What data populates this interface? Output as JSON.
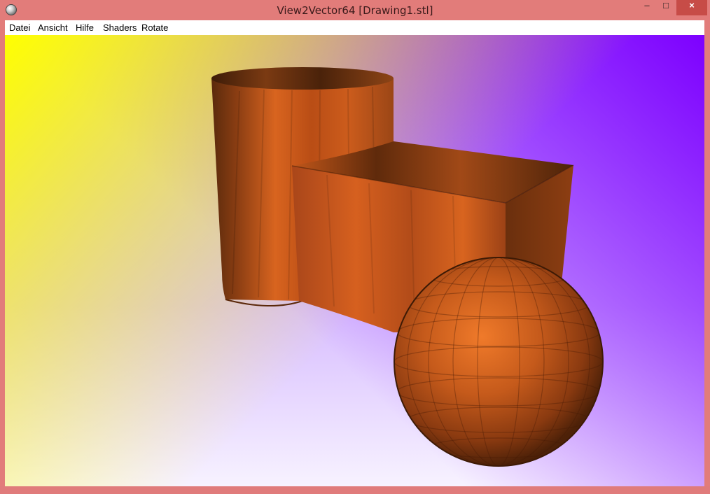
{
  "window": {
    "title": "View2Vector64 [Drawing1.stl]",
    "controls": {
      "minimize": "–",
      "maximize": "□",
      "close": "×"
    }
  },
  "menu": {
    "items": [
      "Datei",
      "Ansicht",
      "Hilfe",
      "Shaders",
      "Rotate"
    ]
  },
  "scene": {
    "object_color": "#c05a1d",
    "shapes": [
      "cylinder",
      "box",
      "sphere"
    ]
  }
}
